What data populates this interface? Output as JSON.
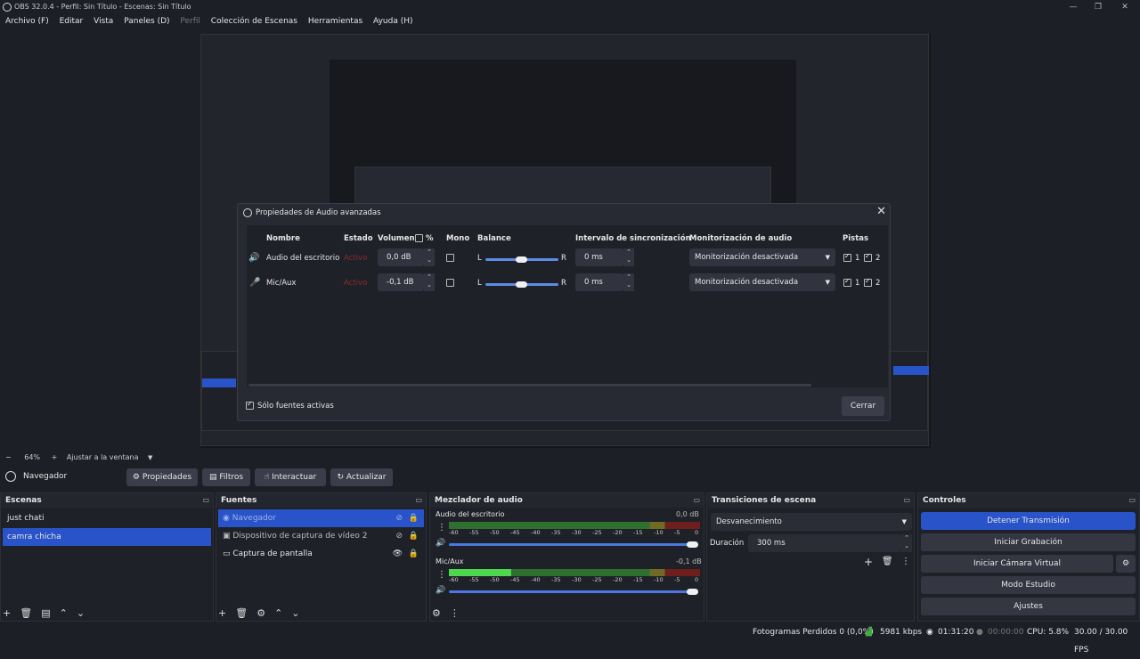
{
  "window": {
    "title": "OBS 32.0.4 - Perfil: Sin Título - Escenas: Sin Título"
  },
  "menu": [
    "Archivo (F)",
    "Editar",
    "Vista",
    "Paneles (D)",
    "Perfil",
    "Colección de Escenas",
    "Herramientas",
    "Ayuda (H)"
  ],
  "preview_controls": {
    "minus": "−",
    "zoom": "64%",
    "plus": "+",
    "fit": "Ajustar a la ventana"
  },
  "dialog": {
    "title": "Propiedades de Audio avanzadas",
    "headers": {
      "name": "Nombre",
      "status": "Estado",
      "volume": "Volumen",
      "percent": "%",
      "mono": "Mono",
      "balance": "Balance",
      "sync": "Intervalo de sincronización",
      "monitor": "Monitorización de audio",
      "tracks": "Pistas"
    },
    "rows": [
      {
        "name": "Audio del escritorio",
        "status": "Activo",
        "volume": "0,0 dB",
        "balance_l": "L",
        "balance_r": "R",
        "sync": "0 ms",
        "monitor": "Monitorización desactivada",
        "track1": "1",
        "track2": "2"
      },
      {
        "name": "Mic/Aux",
        "status": "Activo",
        "volume": "-0,1 dB",
        "balance_l": "L",
        "balance_r": "R",
        "sync": "0 ms",
        "monitor": "Monitorización desactivada",
        "track1": "1",
        "track2": "2"
      }
    ],
    "only_active": "Sólo fuentes activas",
    "close_button": "Cerrar"
  },
  "nav_bar": {
    "source": "Navegador",
    "properties": "Propiedades",
    "filters": "Filtros",
    "interact": "Interactuar",
    "refresh": "Actualizar"
  },
  "scenes": {
    "title": "Escenas",
    "items": [
      "just chati",
      "camra chicha"
    ]
  },
  "sources": {
    "title": "Fuentes",
    "items": [
      "Navegador",
      "Dispositivo de captura de vídeo 2",
      "Captura de pantalla"
    ]
  },
  "mixer": {
    "title": "Mezclador de audio",
    "channels": [
      {
        "name": "Audio del escritorio",
        "db": "0,0 dB"
      },
      {
        "name": "Mic/Aux",
        "db": "-0,1 dB"
      }
    ],
    "ticks": [
      "-60",
      "-55",
      "-50",
      "-45",
      "-40",
      "-35",
      "-30",
      "-25",
      "-20",
      "-15",
      "-10",
      "-5",
      "0"
    ]
  },
  "transitions": {
    "title": "Transiciones de escena",
    "selected": "Desvanecimiento",
    "duration_label": "Duración",
    "duration": "300 ms"
  },
  "controls": {
    "title": "Controles",
    "buttons": [
      "Detener Transmisión",
      "Iniciar Grabación",
      "Iniciar Cámara Virtual",
      "Modo Estudio",
      "Ajustes"
    ]
  },
  "status": {
    "dropped": "Fotogramas Perdidos 0 (0,0%)",
    "kbps": "5981 kbps",
    "stream_time": "01:31:20",
    "rec_time": "00:00:00",
    "cpu": "CPU: 5.8%",
    "fps": "30.00 / 30.00 FPS"
  },
  "colors": {
    "accent": "#2953c9",
    "meter_green": "#3fae3f",
    "meter_yellow": "#8a8a2a",
    "meter_red": "#8a2020",
    "status_active": "#c0392b"
  }
}
